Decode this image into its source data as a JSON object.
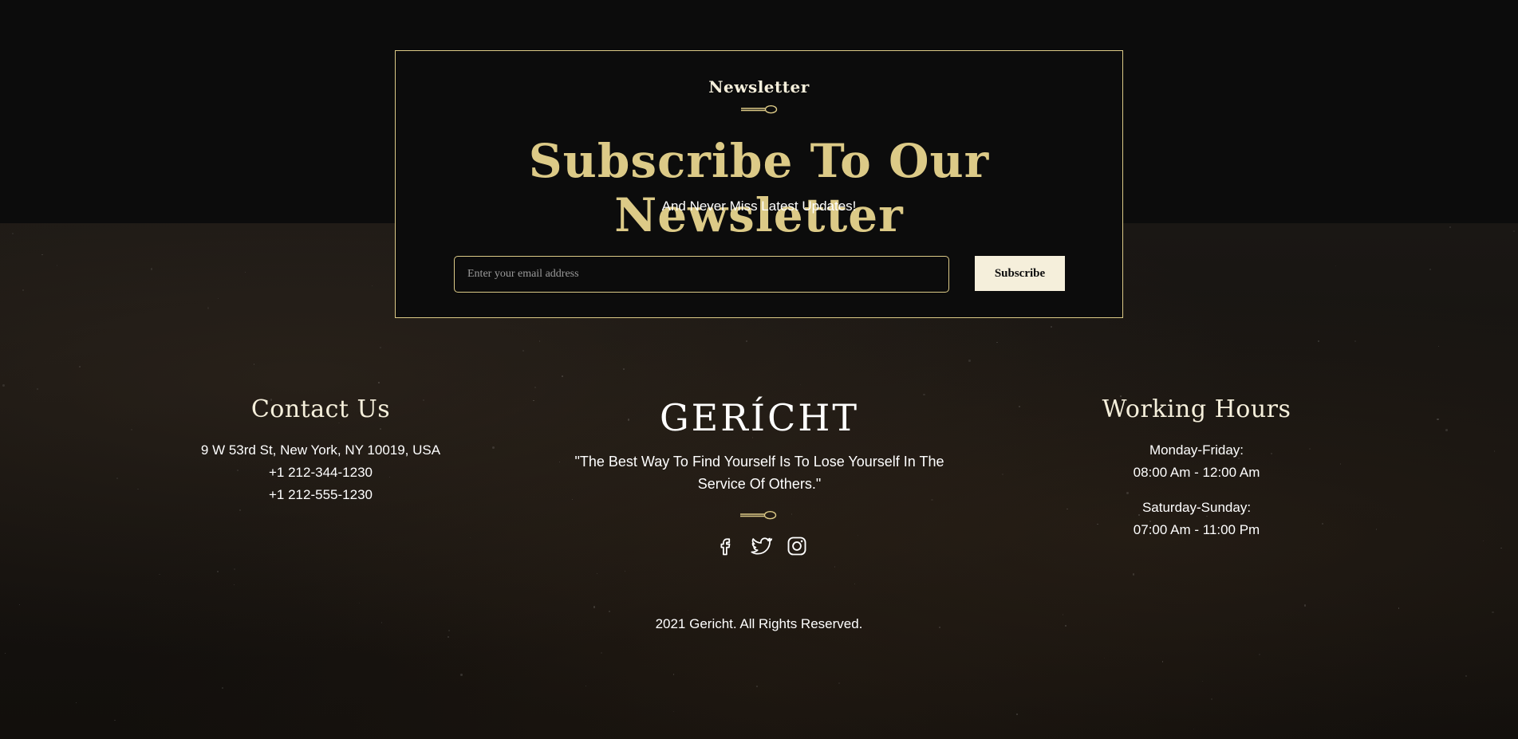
{
  "colors": {
    "background": "#0c0c0c",
    "gold": "#dcca87",
    "cream": "#f5efdb",
    "white": "#ffffff"
  },
  "newsletter": {
    "kicker": "Newsletter",
    "heading": "Subscribe To Our Newsletter",
    "subheading": "And Never Miss Latest Updates!",
    "email_placeholder": "Enter your email address",
    "email_value": "",
    "subscribe_label": "Subscribe",
    "divider_icon": "spoon-icon"
  },
  "footer": {
    "contact": {
      "title": "Contact Us",
      "address": "9 W 53rd St, New York, NY 10019, USA",
      "phone_1": "+1 212-344-1230",
      "phone_2": "+1 212-555-1230"
    },
    "brand": {
      "logo": "GERÍCHT",
      "quote": "\"The Best Way To Find Yourself Is To Lose Yourself In The Service Of Others.\"",
      "divider_icon": "spoon-icon",
      "socials": [
        {
          "name": "facebook-icon"
        },
        {
          "name": "twitter-icon"
        },
        {
          "name": "instagram-icon"
        }
      ]
    },
    "hours": {
      "title": "Working Hours",
      "weekday_label": "Monday-Friday:",
      "weekday_hours": "08:00 Am - 12:00 Am",
      "weekend_label": "Saturday-Sunday:",
      "weekend_hours": "07:00 Am - 11:00 Pm"
    },
    "copyright": "2021 Gericht. All Rights Reserved."
  }
}
